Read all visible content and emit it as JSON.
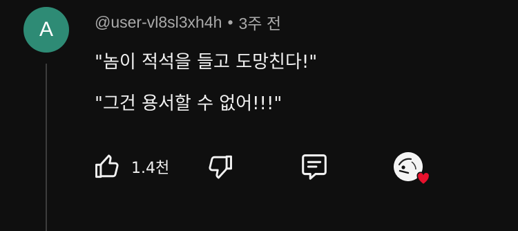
{
  "comment": {
    "avatar_letter": "A",
    "username": "@user-vl8sl3xh4h",
    "separator": "•",
    "timestamp": "3주 전",
    "lines": [
      "\"놈이 적석을 들고 도망친다!\"",
      "\"그건 용서할 수 없어!!!\""
    ]
  },
  "actions": {
    "like_count": "1.4천",
    "like_icon": "thumbs-up-icon",
    "dislike_icon": "thumbs-down-icon",
    "reply_icon": "comment-icon",
    "creator_heart_icon": "heart-icon"
  },
  "colors": {
    "background": "#0f0f0f",
    "avatar": "#2e8b75",
    "heart": "#e8112d",
    "secondary_text": "#aaaaaa"
  }
}
